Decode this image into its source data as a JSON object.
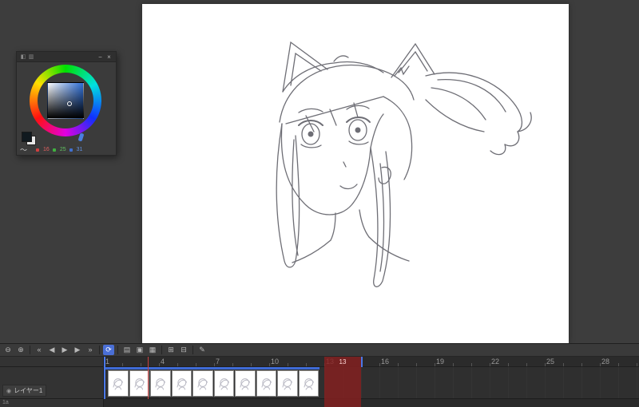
{
  "window": {
    "background": "#3d3d3d",
    "canvas_background": "#ffffff"
  },
  "color_panel": {
    "titlebar": {
      "left_icons": [
        "◧",
        "▥"
      ],
      "minimize": "−",
      "close": "×"
    },
    "selected_hue": "#2f6fd6",
    "main_swatch": "#10191f",
    "rgb": {
      "r": "16",
      "g": "25",
      "b": "31"
    },
    "squiggle_icon": "〜"
  },
  "timeline": {
    "colors": {
      "accent_blue": "#4a6fd6",
      "current_frame_band": "#7e2626",
      "playhead_red": "#c94040"
    },
    "toolbar": [
      {
        "name": "zoom-out",
        "glyph": "⊖"
      },
      {
        "name": "zoom-in",
        "glyph": "⊕"
      },
      {
        "sep": true
      },
      {
        "name": "first-frame",
        "glyph": "«"
      },
      {
        "name": "prev-frame",
        "glyph": "◀"
      },
      {
        "name": "play",
        "glyph": "▶"
      },
      {
        "name": "next-frame",
        "glyph": "▶"
      },
      {
        "name": "last-frame",
        "glyph": "»"
      },
      {
        "sep": true
      },
      {
        "name": "loop-playback",
        "glyph": "⟳",
        "active": true
      },
      {
        "sep": true
      },
      {
        "name": "onion-skin",
        "glyph": "▤"
      },
      {
        "name": "enable-cel",
        "glyph": "▣"
      },
      {
        "name": "light-table",
        "glyph": "▦"
      },
      {
        "sep": true
      },
      {
        "name": "new-cel",
        "glyph": "⊞"
      },
      {
        "name": "delete-cel",
        "glyph": "⊟"
      },
      {
        "sep": true
      },
      {
        "name": "edit-timeline",
        "glyph": "✎"
      }
    ],
    "ruler_numbers": [
      "1",
      "4",
      "7",
      "10",
      "13",
      "16",
      "19",
      "22",
      "25",
      "28"
    ],
    "current_frame": "13",
    "tracks": [
      {
        "label": "レイヤー1",
        "eye_icon": "◉",
        "cel_count": 10
      },
      {
        "label": "1a"
      }
    ]
  }
}
